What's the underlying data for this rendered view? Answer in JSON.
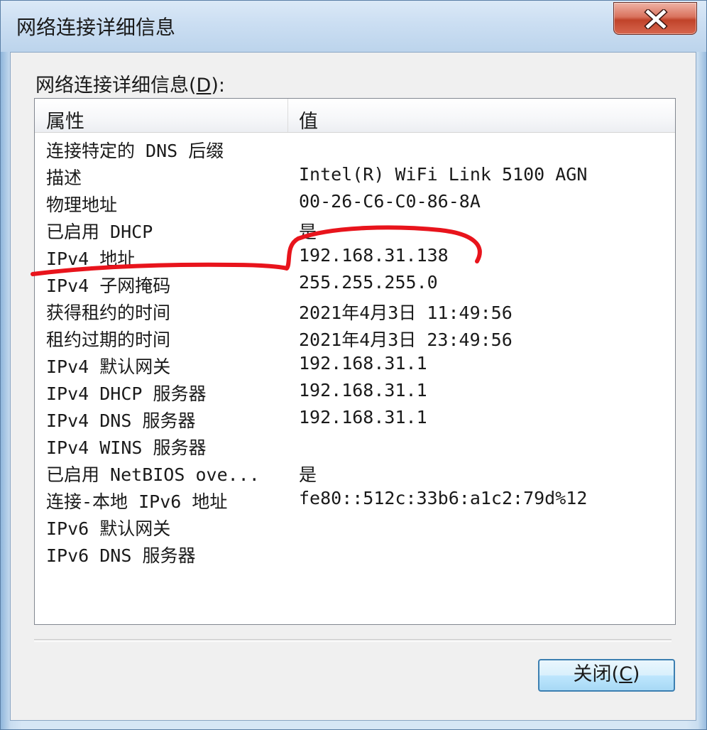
{
  "window": {
    "title": "网络连接详细信息"
  },
  "list": {
    "label": "网络连接详细信息(",
    "label_accel": "D",
    "label_tail": "):",
    "columns": {
      "property": "属性",
      "value": "值"
    },
    "rows": [
      {
        "property": "连接特定的 DNS 后缀",
        "value": ""
      },
      {
        "property": "描述",
        "value": "Intel(R) WiFi Link 5100 AGN"
      },
      {
        "property": "物理地址",
        "value": "00-26-C6-C0-86-8A"
      },
      {
        "property": "已启用 DHCP",
        "value": "是"
      },
      {
        "property": "IPv4 地址",
        "value": "192.168.31.138"
      },
      {
        "property": "IPv4 子网掩码",
        "value": "255.255.255.0"
      },
      {
        "property": "获得租约的时间",
        "value": "2021年4月3日 11:49:56"
      },
      {
        "property": "租约过期的时间",
        "value": "2021年4月3日 23:49:56"
      },
      {
        "property": "IPv4 默认网关",
        "value": "192.168.31.1"
      },
      {
        "property": "IPv4 DHCP 服务器",
        "value": "192.168.31.1"
      },
      {
        "property": "IPv4 DNS 服务器",
        "value": "192.168.31.1"
      },
      {
        "property": "IPv4 WINS 服务器",
        "value": ""
      },
      {
        "property": "已启用 NetBIOS ove...",
        "value": "是"
      },
      {
        "property": "连接-本地 IPv6 地址",
        "value": "fe80::512c:33b6:a1c2:79d%12"
      },
      {
        "property": "IPv6 默认网关",
        "value": ""
      },
      {
        "property": "IPv6 DNS 服务器",
        "value": ""
      }
    ]
  },
  "buttons": {
    "close_label": "关闭(",
    "close_accel": "C",
    "close_tail": ")"
  },
  "colors": {
    "annotation_stroke": "#e8141c"
  },
  "icons": {
    "close": "close-x-icon"
  }
}
